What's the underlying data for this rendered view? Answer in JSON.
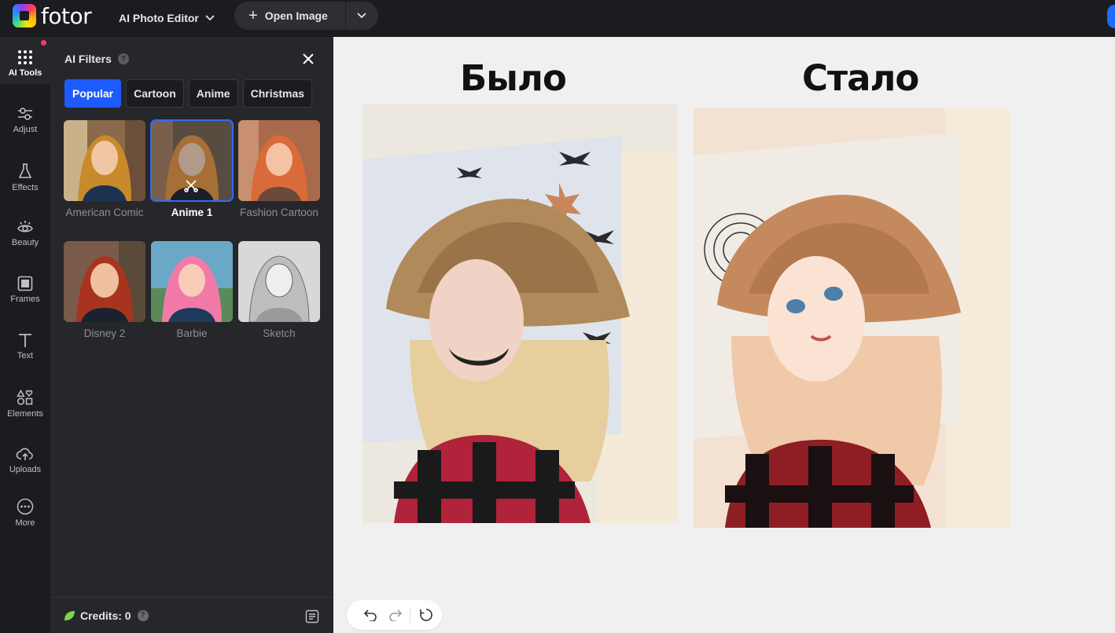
{
  "app": {
    "logo_text": "fotor",
    "editor_menu": "AI Photo Editor",
    "open_image": "Open Image"
  },
  "rail": {
    "items": [
      {
        "label": "AI Tools",
        "icon": "grid-dots-icon",
        "active": true
      },
      {
        "label": "Adjust",
        "icon": "sliders-icon"
      },
      {
        "label": "Effects",
        "icon": "flask-icon"
      },
      {
        "label": "Beauty",
        "icon": "eye-icon"
      },
      {
        "label": "Frames",
        "icon": "frame-icon"
      },
      {
        "label": "Text",
        "icon": "text-icon"
      },
      {
        "label": "Elements",
        "icon": "shapes-icon"
      },
      {
        "label": "Uploads",
        "icon": "cloud-upload-icon"
      },
      {
        "label": "More",
        "icon": "more-icon"
      }
    ]
  },
  "panel": {
    "title": "AI Filters",
    "tabs": [
      {
        "label": "Popular",
        "active": true
      },
      {
        "label": "Cartoon"
      },
      {
        "label": "Anime"
      },
      {
        "label": "Christmas"
      }
    ],
    "filters": [
      {
        "name": "American Comic",
        "selected": false
      },
      {
        "name": "Anime 1",
        "selected": true
      },
      {
        "name": "Fashion Cartoon",
        "selected": false
      },
      {
        "name": "Disney 2",
        "selected": false
      },
      {
        "name": "Barbie",
        "selected": false
      },
      {
        "name": "Sketch",
        "selected": false
      }
    ],
    "credits_label": "Credits: 0"
  },
  "canvas": {
    "before_label": "Было",
    "after_label": "Стало"
  },
  "colors": {
    "accent": "#1e5bff",
    "dark_bg": "#1b1c1f",
    "panel_bg": "#26272b",
    "canvas_bg": "#f0f0f1"
  }
}
